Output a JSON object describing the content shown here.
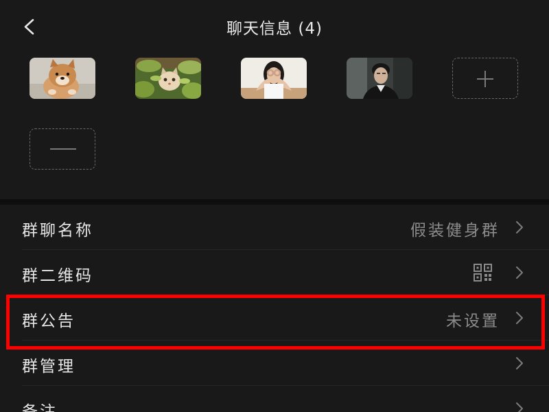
{
  "header": {
    "title": "聊天信息 (4)",
    "back_icon": "chevron-left-icon"
  },
  "members": [
    {
      "name": "member-1",
      "desc": "shiba dog photo avatar"
    },
    {
      "name": "member-2",
      "desc": "cat in leaves photo avatar"
    },
    {
      "name": "member-3",
      "desc": "woman with hands over eyes avatar"
    },
    {
      "name": "member-4",
      "desc": "man portrait avatar"
    }
  ],
  "actions": {
    "add_icon": "plus-icon",
    "remove_icon": "minus-icon"
  },
  "settings": {
    "group_name": {
      "label": "群聊名称",
      "value": "假装健身群"
    },
    "group_qr": {
      "label": "群二维码",
      "icon": "qr-code-icon"
    },
    "group_notice": {
      "label": "群公告",
      "value": "未设置"
    },
    "group_manage": {
      "label": "群管理"
    },
    "remark": {
      "label": "备注"
    }
  },
  "colors": {
    "background": "#111111",
    "panel": "#191919",
    "text_primary": "#e6e6e6",
    "text_secondary": "#8c8c8c",
    "highlight": "#ff0000"
  }
}
